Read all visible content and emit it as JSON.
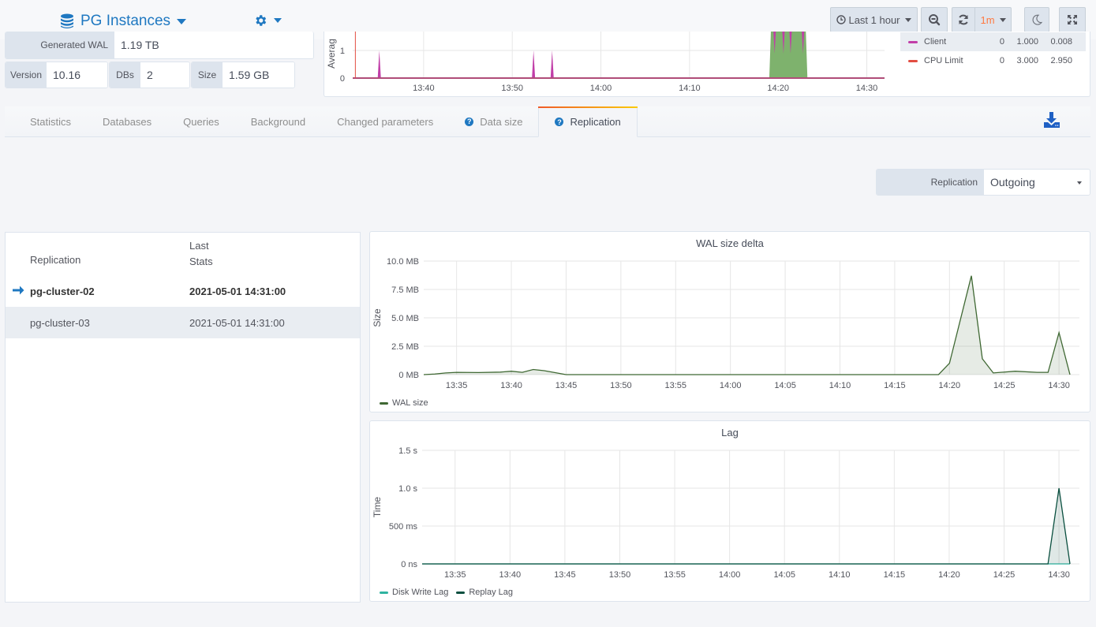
{
  "nav": {
    "title": "PG Instances",
    "time_range": "Last 1 hour",
    "refresh_interval": "1m"
  },
  "stats": {
    "generated_wal": {
      "label": "Generated WAL",
      "value": "1.19 TB"
    },
    "version": {
      "label": "Version",
      "value": "10.16"
    },
    "dbs": {
      "label": "DBs",
      "value": "2"
    },
    "size": {
      "label": "Size",
      "value": "1.59 GB"
    }
  },
  "mini_chart": {
    "ylabel": "Averag",
    "y_ticks": [
      "0",
      "1"
    ],
    "x_ticks": [
      "13:40",
      "13:50",
      "14:00",
      "14:10",
      "14:20",
      "14:30"
    ],
    "legend": [
      {
        "name": "Client",
        "min": "0",
        "max": "1.000",
        "avg": "0.008",
        "color": "#c13ea8"
      },
      {
        "name": "CPU Limit",
        "min": "0",
        "max": "3.000",
        "avg": "2.950",
        "color": "#e24d42"
      }
    ]
  },
  "tabs": [
    {
      "label": "Statistics",
      "help": false,
      "active": false
    },
    {
      "label": "Databases",
      "help": false,
      "active": false
    },
    {
      "label": "Queries",
      "help": false,
      "active": false
    },
    {
      "label": "Background",
      "help": false,
      "active": false
    },
    {
      "label": "Changed parameters",
      "help": false,
      "active": false
    },
    {
      "label": "Data size",
      "help": true,
      "active": false
    },
    {
      "label": "Replication",
      "help": true,
      "active": true
    }
  ],
  "replication_filter": {
    "label": "Replication",
    "value": "Outgoing"
  },
  "replication_table": {
    "columns": [
      "Replication",
      "Last\nStats"
    ],
    "column_1": "Replication",
    "column_2_line1": "Last",
    "column_2_line2": "Stats",
    "rows": [
      {
        "name": "pg-cluster-02",
        "last_stats": "2021-05-01 14:31:00",
        "selected": true
      },
      {
        "name": "pg-cluster-03",
        "last_stats": "2021-05-01 14:31:00",
        "selected": false
      }
    ]
  },
  "chart_data": [
    {
      "type": "area",
      "title": "WAL size delta",
      "xlabel": "",
      "ylabel": "Size",
      "y_unit": "MB",
      "ylim": [
        0,
        10
      ],
      "y_ticks": [
        "0 MB",
        "2.5 MB",
        "5.0 MB",
        "7.5 MB",
        "10.0 MB"
      ],
      "x_ticks": [
        "13:35",
        "13:40",
        "13:45",
        "13:50",
        "13:55",
        "14:00",
        "14:05",
        "14:10",
        "14:15",
        "14:20",
        "14:25",
        "14:30"
      ],
      "x_range": [
        "13:32",
        "14:31"
      ],
      "grid": true,
      "legend_position": "bottom-left",
      "series": [
        {
          "name": "WAL size",
          "color": "#3f6833",
          "x": [
            "13:32",
            "13:33",
            "13:34",
            "13:35",
            "13:37",
            "13:39",
            "13:40",
            "13:41",
            "13:42",
            "13:43",
            "13:45",
            "14:19",
            "14:20",
            "14:22",
            "14:23",
            "14:24",
            "14:26",
            "14:28",
            "14:29",
            "14:30",
            "14:31"
          ],
          "values": [
            0,
            0.05,
            0.15,
            0.2,
            0.18,
            0.22,
            0.3,
            0.2,
            0.45,
            0.35,
            0,
            0,
            1.0,
            8.7,
            1.4,
            0.15,
            0.3,
            0.2,
            0.2,
            3.7,
            0
          ]
        }
      ]
    },
    {
      "type": "area",
      "title": "Lag",
      "xlabel": "",
      "ylabel": "Time",
      "y_unit": "s",
      "ylim": [
        0,
        1.5
      ],
      "y_ticks": [
        "0 ns",
        "500 ms",
        "1.0 s",
        "1.5 s"
      ],
      "x_ticks": [
        "13:35",
        "13:40",
        "13:45",
        "13:50",
        "13:55",
        "14:00",
        "14:05",
        "14:10",
        "14:15",
        "14:20",
        "14:25",
        "14:30"
      ],
      "x_range": [
        "13:32",
        "14:31"
      ],
      "grid": true,
      "legend_position": "bottom-left",
      "series": [
        {
          "name": "Disk Write Lag",
          "color": "#2fb3a0",
          "x": [
            "13:32",
            "14:31"
          ],
          "values": [
            0,
            0
          ]
        },
        {
          "name": "Replay Lag",
          "color": "#0a4f3f",
          "x": [
            "13:32",
            "14:29",
            "14:30",
            "14:31"
          ],
          "values": [
            0,
            0,
            1.0,
            0
          ]
        }
      ]
    }
  ]
}
